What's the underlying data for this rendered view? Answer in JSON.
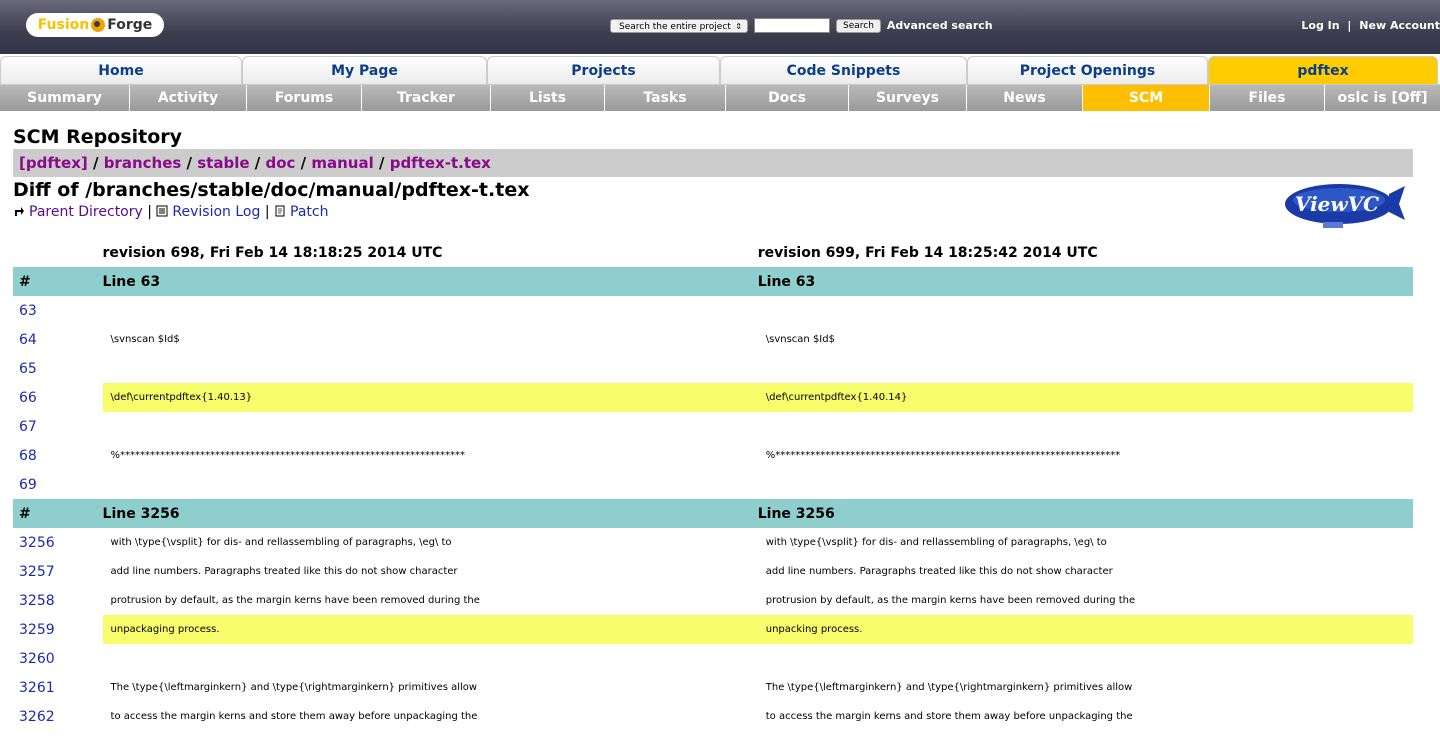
{
  "header": {
    "logo_left": "Fusion",
    "logo_right": "Forge",
    "search_scope": "Search the entire project",
    "search_button": "Search",
    "advanced_search": "Advanced search",
    "login": "Log In",
    "separator": "|",
    "new_account": "New Account"
  },
  "main_tabs": [
    {
      "label": "Home"
    },
    {
      "label": "My Page"
    },
    {
      "label": "Projects"
    },
    {
      "label": "Code Snippets"
    },
    {
      "label": "Project Openings"
    },
    {
      "label": "pdftex"
    }
  ],
  "sub_tabs": [
    {
      "label": "Summary"
    },
    {
      "label": "Activity"
    },
    {
      "label": "Forums"
    },
    {
      "label": "Tracker"
    },
    {
      "label": "Lists"
    },
    {
      "label": "Tasks"
    },
    {
      "label": "Docs"
    },
    {
      "label": "Surveys"
    },
    {
      "label": "News"
    },
    {
      "label": "SCM"
    },
    {
      "label": "Files"
    },
    {
      "label": "oslc is [Off]"
    }
  ],
  "page": {
    "title": "SCM Repository",
    "breadcrumb": [
      "[pdftex]",
      "branches",
      "stable",
      "doc",
      "manual",
      "pdftex-t.tex"
    ],
    "breadcrumb_sep": "/",
    "diff_title": "Diff of /branches/stable/doc/manual/pdftex-t.tex",
    "nav": {
      "parent": "Parent Directory",
      "revlog": "Revision Log",
      "patch": "Patch",
      "sep": "|"
    },
    "viewvc_logo": "ViewVC"
  },
  "diff": {
    "left_rev": "revision 698, Fri Feb 14 18:18:25 2014 UTC",
    "right_rev": "revision 699, Fri Feb 14 18:25:42 2014 UTC",
    "hash": "#",
    "sections": [
      {
        "label_left": "Line 63",
        "label_right": "Line 63",
        "rows": [
          {
            "n": "63",
            "l": "",
            "r": "",
            "changed": false
          },
          {
            "n": "64",
            "l": "\\svnscan $Id$",
            "r": "\\svnscan $Id$",
            "changed": false
          },
          {
            "n": "65",
            "l": "",
            "r": "",
            "changed": false
          },
          {
            "n": "66",
            "l": "\\def\\currentpdftex{1.40.13}",
            "r": "\\def\\currentpdftex{1.40.14}",
            "changed": true
          },
          {
            "n": "67",
            "l": "",
            "r": "",
            "changed": false
          },
          {
            "n": "68",
            "l": "%*********************************************************************",
            "r": "%*********************************************************************",
            "changed": false
          },
          {
            "n": "69",
            "l": "",
            "r": "",
            "changed": false
          }
        ]
      },
      {
        "label_left": "Line 3256",
        "label_right": "Line 3256",
        "rows": [
          {
            "n": "3256",
            "l": "with \\type{\\vsplit} for dis- and rellassembling of paragraphs, \\eg\\ to",
            "r": "with \\type{\\vsplit} for dis- and rellassembling of paragraphs, \\eg\\ to",
            "changed": false
          },
          {
            "n": "3257",
            "l": "add line numbers. Paragraphs treated like this do not show character",
            "r": "add line numbers. Paragraphs treated like this do not show character",
            "changed": false
          },
          {
            "n": "3258",
            "l": "protrusion by default, as the margin kerns have been removed during the",
            "r": "protrusion by default, as the margin kerns have been removed during the",
            "changed": false
          },
          {
            "n": "3259",
            "l": "unpackaging process.",
            "r": "unpacking process.",
            "changed": true
          },
          {
            "n": "3260",
            "l": "",
            "r": "",
            "changed": false
          },
          {
            "n": "3261",
            "l": "The \\type{\\leftmarginkern} and \\type{\\rightmarginkern} primitives allow",
            "r": "The \\type{\\leftmarginkern} and \\type{\\rightmarginkern} primitives allow",
            "changed": false
          },
          {
            "n": "3262",
            "l": "to access the margin kerns and store them away before unpackaging the",
            "r": "to access the margin kerns and store them away before unpackaging the",
            "changed": false
          }
        ]
      }
    ]
  }
}
